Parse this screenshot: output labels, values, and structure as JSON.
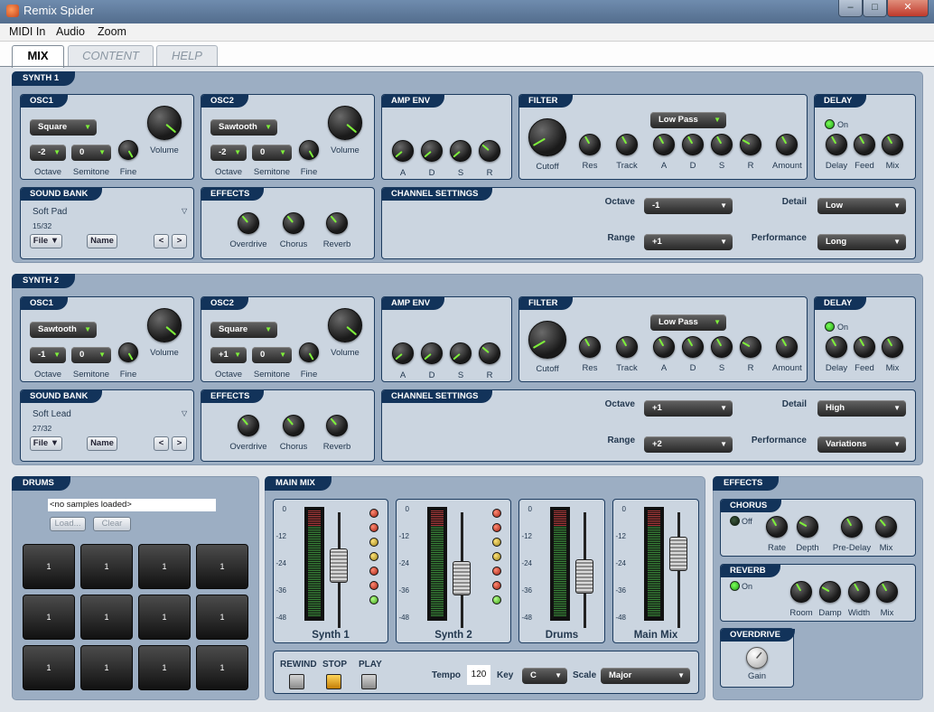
{
  "window": {
    "title": "Remix Spider"
  },
  "menu": [
    "MIDI In",
    "Audio",
    "Zoom"
  ],
  "tabs": [
    "MIX",
    "CONTENT",
    "HELP"
  ],
  "synth1": {
    "title": "SYNTH 1",
    "osc1": {
      "title": "OSC1",
      "wave": "Square",
      "octave": "-2",
      "semitone": "0",
      "labels": [
        "Octave",
        "Semitone",
        "Fine",
        "Volume"
      ]
    },
    "osc2": {
      "title": "OSC2",
      "wave": "Sawtooth",
      "octave": "-2",
      "semitone": "0",
      "labels": [
        "Octave",
        "Semitone",
        "Fine",
        "Volume"
      ]
    },
    "ampenv": {
      "title": "AMP ENV",
      "labels": [
        "A",
        "D",
        "S",
        "R"
      ]
    },
    "filter": {
      "title": "FILTER",
      "type": "Low Pass",
      "labels": [
        "Cutoff",
        "Res",
        "Track",
        "A",
        "D",
        "S",
        "R",
        "Amount"
      ]
    },
    "delay": {
      "title": "DELAY",
      "state": "On",
      "labels": [
        "Delay",
        "Feed",
        "Mix"
      ]
    },
    "soundbank": {
      "title": "SOUND BANK",
      "patch": "Soft Pad",
      "count": "15/32",
      "file": "File ▼",
      "name": "Name",
      "prev": "<",
      "next": ">"
    },
    "effects": {
      "title": "EFFECTS",
      "labels": [
        "Overdrive",
        "Chorus",
        "Reverb"
      ]
    },
    "channel": {
      "title": "CHANNEL SETTINGS",
      "octave_label": "Octave",
      "octave": "-1",
      "range_label": "Range",
      "range": "+1",
      "detail_label": "Detail",
      "detail": "Low",
      "perf_label": "Performance",
      "perf": "Long"
    }
  },
  "synth2": {
    "title": "SYNTH 2",
    "osc1": {
      "title": "OSC1",
      "wave": "Sawtooth",
      "octave": "-1",
      "semitone": "0",
      "labels": [
        "Octave",
        "Semitone",
        "Fine",
        "Volume"
      ]
    },
    "osc2": {
      "title": "OSC2",
      "wave": "Square",
      "octave": "+1",
      "semitone": "0",
      "labels": [
        "Octave",
        "Semitone",
        "Fine",
        "Volume"
      ]
    },
    "ampenv": {
      "title": "AMP ENV",
      "labels": [
        "A",
        "D",
        "S",
        "R"
      ]
    },
    "filter": {
      "title": "FILTER",
      "type": "Low Pass",
      "labels": [
        "Cutoff",
        "Res",
        "Track",
        "A",
        "D",
        "S",
        "R",
        "Amount"
      ]
    },
    "delay": {
      "title": "DELAY",
      "state": "On",
      "labels": [
        "Delay",
        "Feed",
        "Mix"
      ]
    },
    "soundbank": {
      "title": "SOUND BANK",
      "patch": "Soft Lead",
      "count": "27/32",
      "file": "File ▼",
      "name": "Name",
      "prev": "<",
      "next": ">"
    },
    "effects": {
      "title": "EFFECTS",
      "labels": [
        "Overdrive",
        "Chorus",
        "Reverb"
      ]
    },
    "channel": {
      "title": "CHANNEL SETTINGS",
      "octave_label": "Octave",
      "octave": "+1",
      "range_label": "Range",
      "range": "+2",
      "detail_label": "Detail",
      "detail": "High",
      "perf_label": "Performance",
      "perf": "Variations"
    }
  },
  "drums": {
    "title": "DRUMS",
    "samples": "<no samples loaded>",
    "load": "Load...",
    "clear": "Clear",
    "pad_label": "1"
  },
  "mainmix": {
    "title": "MAIN MIX",
    "scale": [
      "0",
      "-12",
      "-24",
      "-36",
      "-48"
    ],
    "strips": [
      {
        "name": "Synth 1",
        "level": 0.55
      },
      {
        "name": "Synth 2",
        "level": 0.4
      },
      {
        "name": "Drums",
        "level": 0.42
      },
      {
        "name": "Main Mix",
        "level": 0.7
      }
    ],
    "transport": {
      "rewind": "REWIND",
      "stop": "STOP",
      "play": "PLAY",
      "tempo_label": "Tempo",
      "tempo": "120",
      "key_label": "Key",
      "key": "C",
      "scale_label": "Scale",
      "scale": "Major"
    }
  },
  "effects": {
    "title": "EFFECTS",
    "chorus": {
      "title": "CHORUS",
      "state": "Off",
      "labels": [
        "Rate",
        "Depth",
        "Pre-Delay",
        "Mix"
      ]
    },
    "reverb": {
      "title": "REVERB",
      "state": "On",
      "labels": [
        "Room",
        "Damp",
        "Width",
        "Mix"
      ]
    },
    "overdrive": {
      "title": "OVERDRIVE",
      "labels": [
        "Gain"
      ]
    }
  },
  "colors": {
    "accent": "#7ef03a",
    "panel": "#cbd5e0",
    "header": "#12335a",
    "section": "#9caec3"
  }
}
